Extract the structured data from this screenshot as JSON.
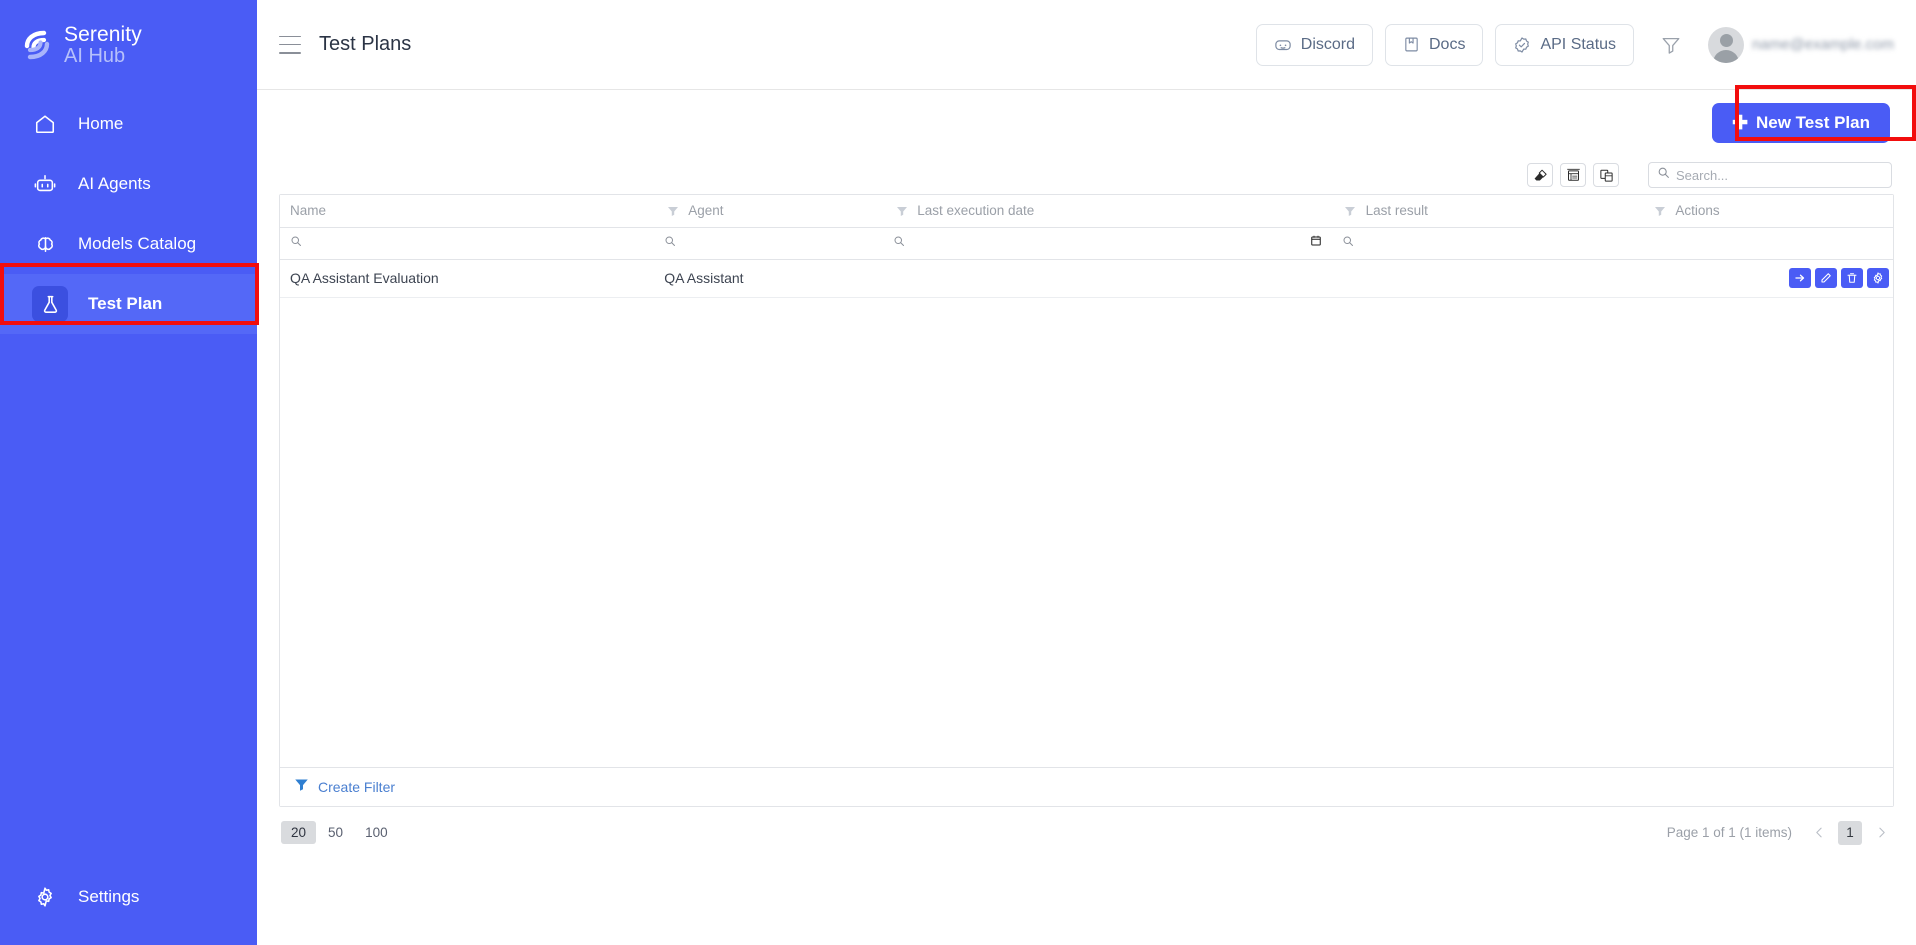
{
  "brand": {
    "logo_icon": "serenity-logo-icon",
    "title": "Serenity",
    "subtitle": "AI Hub",
    "accent_color": "#4a5cf5",
    "sidebar_color": "#4a5cf5",
    "annotation_color": "#f20d0d"
  },
  "sidebar": {
    "items": [
      {
        "label": "Home",
        "icon": "home-icon",
        "active": false
      },
      {
        "label": "AI Agents",
        "icon": "robot-icon",
        "active": false
      },
      {
        "label": "Models Catalog",
        "icon": "brain-icon",
        "active": false
      },
      {
        "label": "Test Plan",
        "icon": "flask-icon",
        "active": true
      }
    ],
    "bottom": {
      "label": "Settings",
      "icon": "gear-icon"
    }
  },
  "topbar": {
    "menu_icon": "hamburger-icon",
    "title": "Test Plans",
    "buttons": [
      {
        "label": "Discord",
        "icon": "discord-icon"
      },
      {
        "label": "Docs",
        "icon": "book-icon"
      },
      {
        "label": "API Status",
        "icon": "check-badge-icon"
      }
    ],
    "filter_icon": "funnel-icon",
    "user": {
      "avatar_icon": "avatar-icon",
      "email": "name@example.com"
    }
  },
  "actions": {
    "new_test_plan": {
      "label": "New Test Plan",
      "icon": "plus-icon"
    }
  },
  "grid_toolbar": {
    "icons": [
      {
        "name": "clear-filters-icon"
      },
      {
        "name": "fit-columns-icon"
      },
      {
        "name": "column-chooser-icon"
      }
    ],
    "search": {
      "placeholder": "Search...",
      "value": "",
      "icon": "search-icon"
    }
  },
  "table": {
    "columns": [
      {
        "label": "Name",
        "filter_icon": false,
        "filter_placeholder": "",
        "search_icon": true,
        "calendar_icon": false
      },
      {
        "label": "Agent",
        "filter_icon": true,
        "filter_placeholder": "",
        "search_icon": true,
        "calendar_icon": false
      },
      {
        "label": "Last execution date",
        "filter_icon": true,
        "filter_placeholder": "",
        "search_icon": true,
        "calendar_icon": true
      },
      {
        "label": "Last result",
        "filter_icon": true,
        "filter_placeholder": "",
        "search_icon": true,
        "calendar_icon": false
      },
      {
        "label": "Actions",
        "filter_icon": true,
        "filter_placeholder": "",
        "search_icon": false,
        "calendar_icon": false
      }
    ],
    "rows": [
      {
        "name": "QA Assistant Evaluation",
        "agent": "QA Assistant",
        "last_execution_date": "",
        "last_result": "",
        "actions": [
          {
            "name": "run-test-plan-button",
            "icon": "arrow-right-icon"
          },
          {
            "name": "edit-test-plan-button",
            "icon": "pencil-icon"
          },
          {
            "name": "delete-test-plan-button",
            "icon": "trash-icon"
          },
          {
            "name": "settings-test-plan-button",
            "icon": "gear-icon"
          }
        ]
      }
    ]
  },
  "create_filter": {
    "label": "Create Filter",
    "icon": "funnel-icon"
  },
  "pagination": {
    "page_sizes": [
      "20",
      "50",
      "100"
    ],
    "selected_page_size": "20",
    "info": "Page 1 of 1 (1 items)",
    "current_page": "1",
    "prev_icon": "chevron-left-icon",
    "next_icon": "chevron-right-icon"
  },
  "annotations": [
    {
      "name": "sidebar-test-plan-highlight"
    },
    {
      "name": "new-test-plan-highlight"
    }
  ]
}
